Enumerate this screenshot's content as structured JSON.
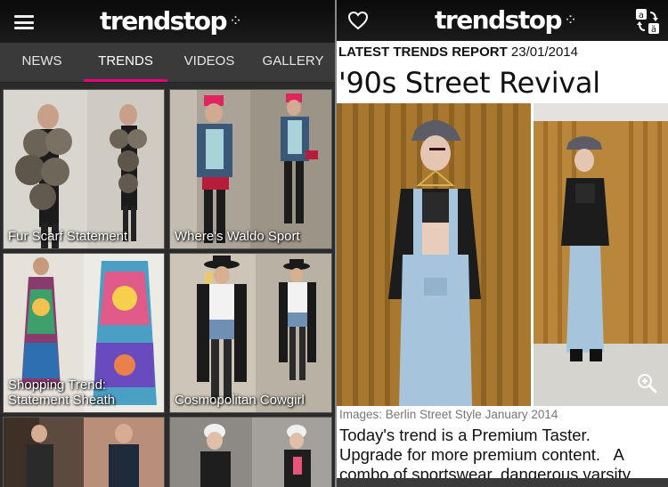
{
  "left_screen": {
    "logo": "trendstop",
    "tabs": [
      {
        "label": "NEWS",
        "active": false
      },
      {
        "label": "TRENDS",
        "active": true
      },
      {
        "label": "VIDEOS",
        "active": false
      },
      {
        "label": "GALLERY",
        "active": false
      }
    ],
    "tiles": [
      {
        "caption": "Fur Scarf Statement"
      },
      {
        "caption": "Where's Waldo Sport"
      },
      {
        "caption_line1": "Shopping Trend:",
        "caption_line2": "Statement Sheath"
      },
      {
        "caption": "Cosmopolitan Cowgirl"
      },
      {
        "caption": ""
      },
      {
        "caption": ""
      }
    ]
  },
  "right_screen": {
    "logo": "trendstop",
    "report_label": "LATEST TRENDS REPORT",
    "report_date": "23/01/2014",
    "headline": "'90s Street Revival",
    "image_credit": "Images: Berlin Street Style January 2014",
    "body_line1": "Today's trend is a Premium Taster.",
    "body_line2": "Upgrade for more premium content.   A",
    "body_line3": "combo of sportswear, dangerous varsity"
  },
  "icons": [
    "menu-icon",
    "heart-icon",
    "translate-icon",
    "zoom-in-icon"
  ],
  "colors": {
    "accent": "#e6007e",
    "topbar": "#111111",
    "tabbar": "#3a3a3a"
  }
}
